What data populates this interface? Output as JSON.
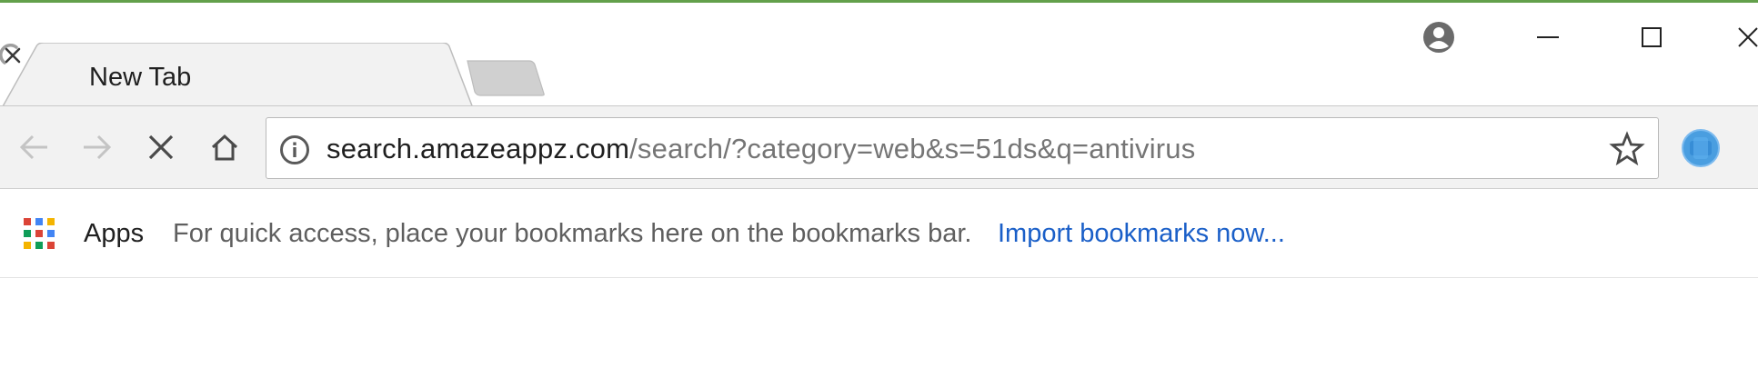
{
  "tabs": [
    {
      "title": "New Tab",
      "loading": true
    }
  ],
  "toolbar": {
    "url_host": "search.amazeappz.com",
    "url_path": "/search/?category=web&s=51ds&q=antivirus",
    "loading": true
  },
  "bookmarks_bar": {
    "apps_label": "Apps",
    "hint_text": "For quick access, place your bookmarks here on the bookmarks bar.",
    "import_link": "Import bookmarks now..."
  },
  "icons": {
    "back": "arrow-left-icon",
    "forward": "arrow-right-icon",
    "stop": "close-x-icon",
    "home": "home-icon",
    "info": "info-circle-icon",
    "star": "star-outline-icon",
    "profile": "person-circle-icon",
    "apps": "apps-grid-icon",
    "extension": "globe-blue-icon"
  },
  "colors": {
    "top_accent": "#63a04b",
    "link": "#1a5fc8",
    "url_path": "#757575",
    "toolbar_bg": "#f2f2f2"
  }
}
